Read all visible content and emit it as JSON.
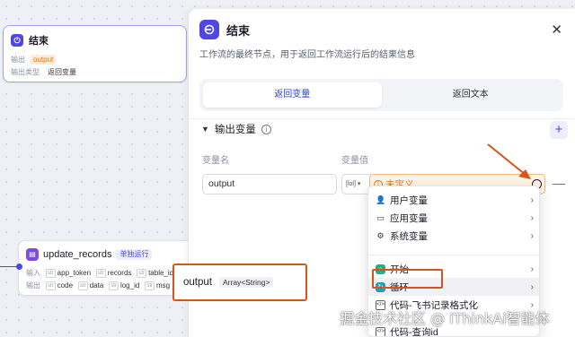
{
  "canvas": {
    "end_node": {
      "title": "结束",
      "row1_label": "输出",
      "row1_value": "output",
      "row2_label": "输出类型",
      "row2_value": "返回变量"
    },
    "update_node": {
      "title": "update_records",
      "tag": "单独运行",
      "in_label": "输入",
      "out_label": "输出",
      "inputs": [
        "app_token",
        "records",
        "table_id"
      ],
      "outputs": [
        "code",
        "data",
        "log_id",
        "msg"
      ],
      "badge": "str"
    }
  },
  "panel": {
    "title": "结束",
    "description": "工作流的最终节点，用于返回工作流运行后的结果信息",
    "tabs": [
      {
        "label": "返回变量",
        "active": true
      },
      {
        "label": "返回文本",
        "active": false
      }
    ],
    "section_title": "输出变量",
    "col_name": "变量名",
    "col_value": "变量值",
    "var_name": "output",
    "type_glyph": "[lol]",
    "value_placeholder": "未定义"
  },
  "dropdown": {
    "items": [
      {
        "label": "用户变量",
        "icon": "user-icon"
      },
      {
        "label": "应用变量",
        "icon": "app-icon"
      },
      {
        "label": "系统变量",
        "icon": "gear-icon"
      },
      {
        "label": "开始",
        "icon": "start-node-icon"
      },
      {
        "label": "循环",
        "icon": "loop-node-icon"
      },
      {
        "label": "代码-飞书记录格式化",
        "icon": "code-icon"
      },
      {
        "label": "代码-查询id",
        "icon": "code-icon"
      }
    ]
  },
  "popup": {
    "name": "output",
    "type": "Array<String>"
  },
  "watermark": "掘金技术社区 @ iThinkAi智能体",
  "colors": {
    "accent": "#4f46e5",
    "warning": "#e0780f",
    "annotation": "#d9531e"
  }
}
